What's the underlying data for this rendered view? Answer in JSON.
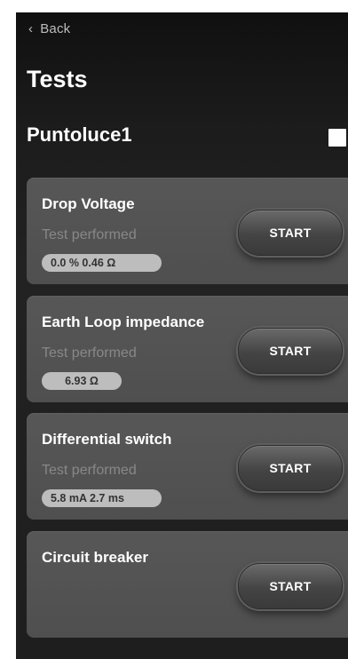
{
  "header": {
    "back_label": "Back",
    "back_icon": "chevron-left-icon",
    "title": "Tests",
    "subtitle": "Puntoluce1"
  },
  "tests": [
    {
      "name": "Drop Voltage",
      "status": "Test performed",
      "result": "0.0 %  0.46 Ω",
      "button": "START"
    },
    {
      "name": "Earth Loop impedance",
      "status": "Test performed",
      "result": "6.93 Ω",
      "button": "START"
    },
    {
      "name": "Differential switch",
      "status": "Test performed",
      "result": "5.8 mA  2.7 ms",
      "button": "START"
    },
    {
      "name": "Circuit breaker",
      "status": "",
      "result": "",
      "button": "START"
    }
  ]
}
